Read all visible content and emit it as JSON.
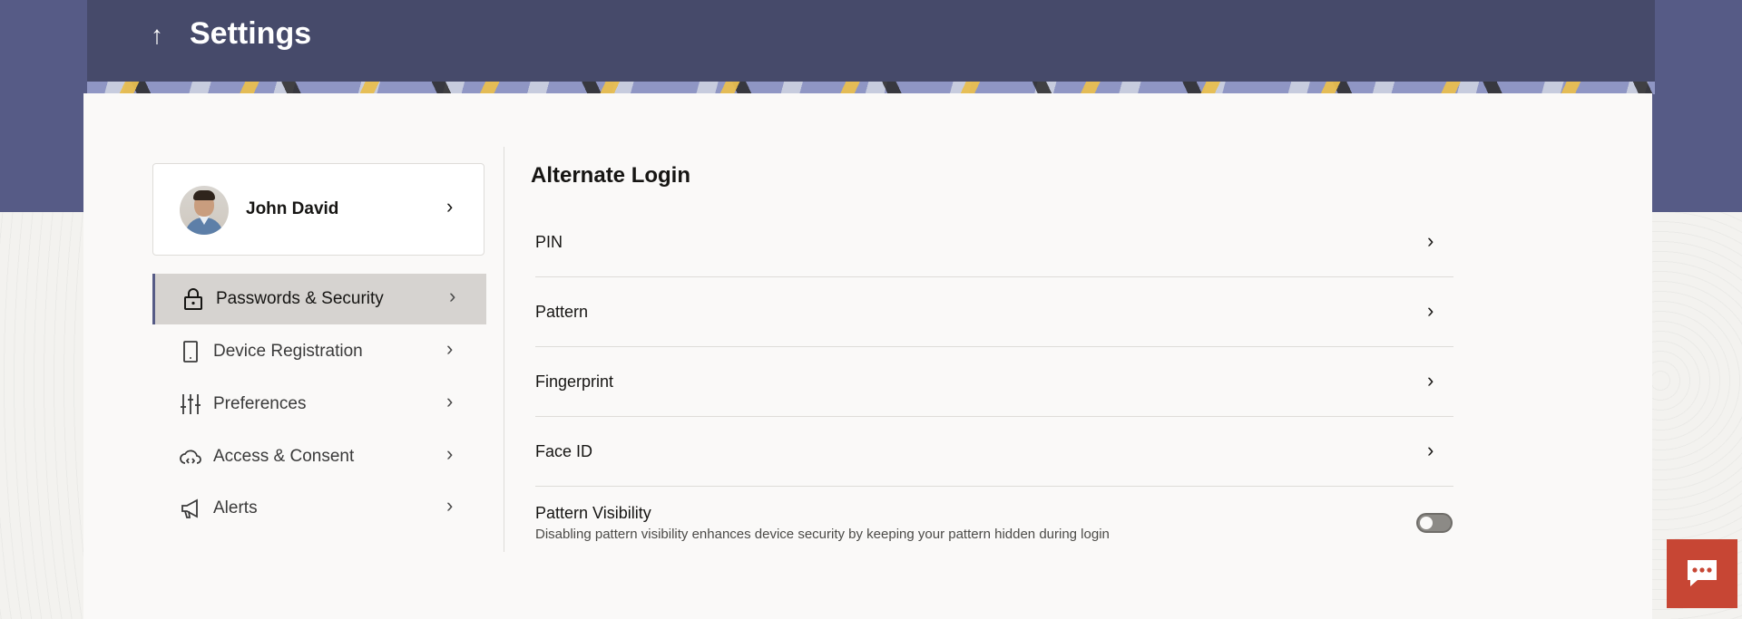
{
  "header": {
    "back_icon": "up-arrow-icon",
    "back_glyph": "↑",
    "title": "Settings",
    "colors": {
      "band": "#565b86",
      "header": "#464a6a"
    }
  },
  "profile": {
    "name": "John David",
    "chevron": "›"
  },
  "sidebar": {
    "items": [
      {
        "label": "Passwords & Security",
        "icon": "lock-icon",
        "active": true,
        "chevron": "›"
      },
      {
        "label": "Device Registration",
        "icon": "device-icon",
        "active": false,
        "chevron": "›"
      },
      {
        "label": "Preferences",
        "icon": "sliders-icon",
        "active": false,
        "chevron": "›"
      },
      {
        "label": "Access & Consent",
        "icon": "cloud-code-icon",
        "active": false,
        "chevron": "›"
      },
      {
        "label": "Alerts",
        "icon": "megaphone-icon",
        "active": false,
        "chevron": "›"
      }
    ]
  },
  "main": {
    "title": "Alternate Login",
    "options": [
      {
        "label": "PIN",
        "chevron": "›"
      },
      {
        "label": "Pattern",
        "chevron": "›"
      },
      {
        "label": "Fingerprint",
        "chevron": "›"
      },
      {
        "label": "Face ID",
        "chevron": "›"
      }
    ],
    "pattern_visibility": {
      "title": "Pattern Visibility",
      "description": "Disabling pattern visibility enhances device security by keeping your pattern hidden during login",
      "enabled": false
    }
  },
  "chat": {
    "icon": "chat-bubble-icon",
    "color": "#c74634"
  }
}
